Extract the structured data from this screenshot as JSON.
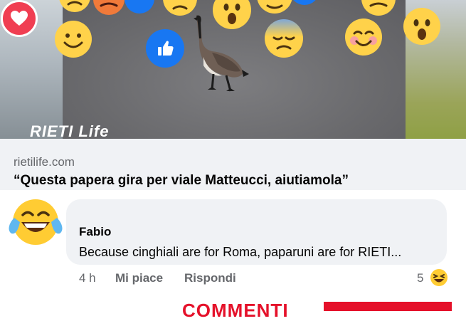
{
  "reactions": {
    "heart_icon": "heart-icon",
    "like_icon": "thumbs-up-icon",
    "faces": [
      "smiling-face",
      "astonished-face",
      "pensive-face",
      "blushing-smile-face",
      "astonished-face",
      "angry-face",
      "tears-of-joy-face"
    ]
  },
  "media": {
    "watermark": "RIETI Life"
  },
  "link_preview": {
    "domain": "rietilife.com",
    "headline": "“Questa papera gira per viale Matteucci, aiutiamola”"
  },
  "comment": {
    "author": "Fabio",
    "text": "Because cinghiali are for Roma, paparuni are for RIETI...",
    "time": "4 h",
    "like_label": "Mi piace",
    "reply_label": "Rispondi",
    "reaction_count": "5"
  },
  "banner": {
    "text": "COMMENTI"
  },
  "colors": {
    "accent_blue": "#1877f2",
    "heart_red": "#f03e52",
    "banner_red": "#e5112a",
    "bubble_gray": "#f0f2f5"
  }
}
